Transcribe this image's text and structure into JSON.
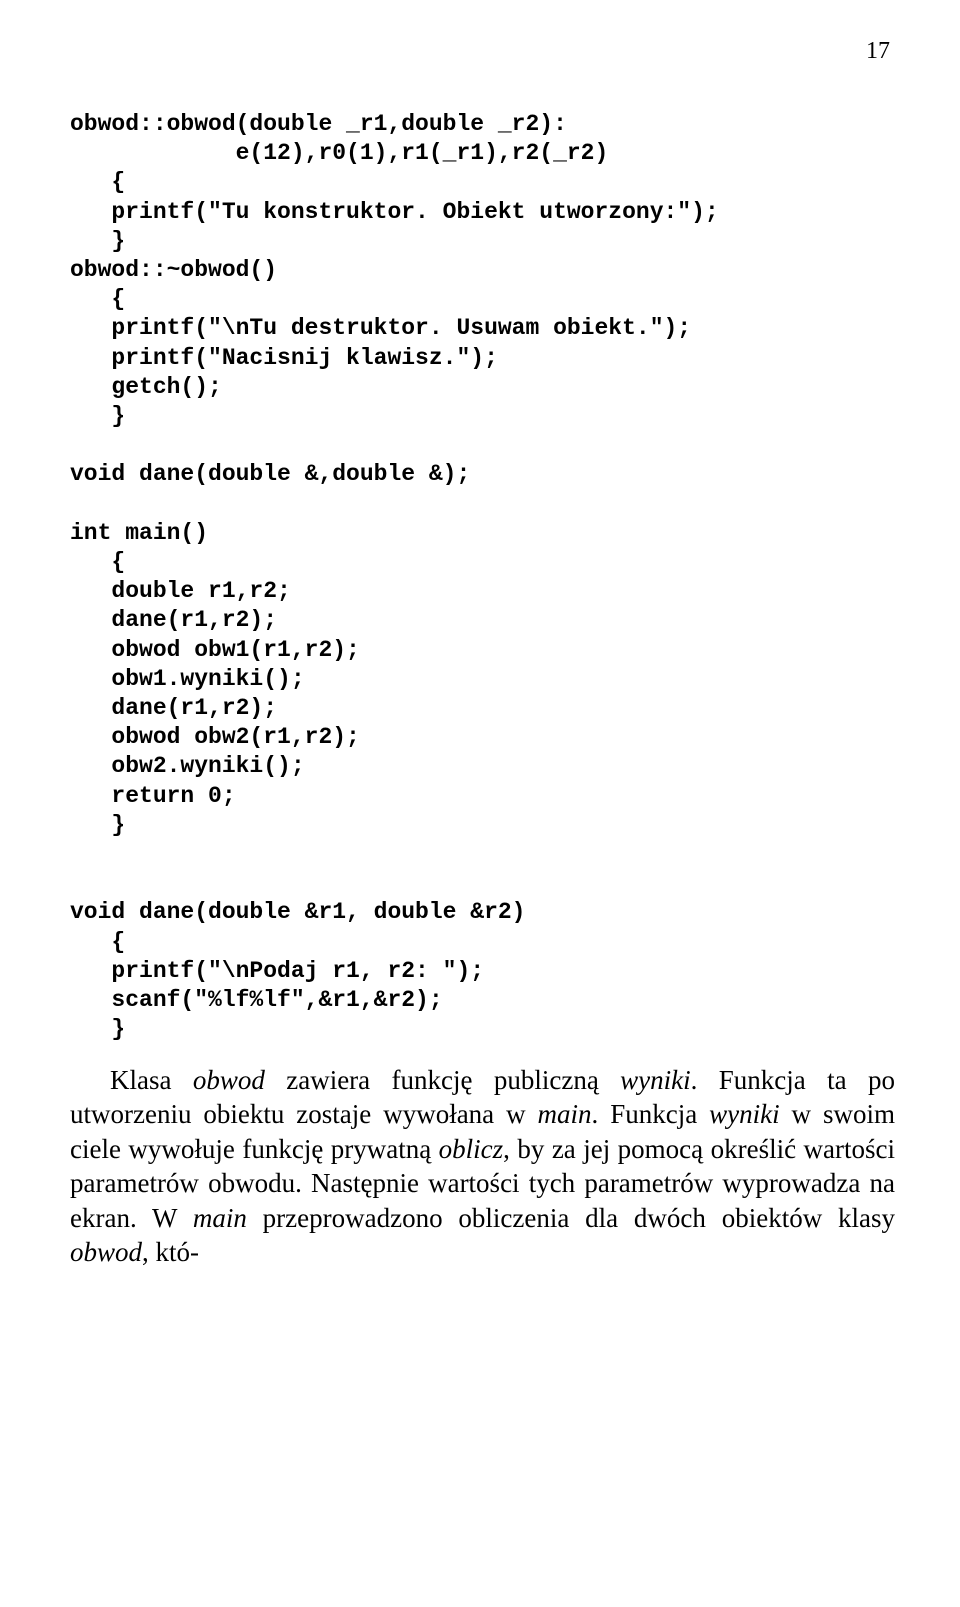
{
  "page_number": "17",
  "code": "obwod::obwod(double _r1,double _r2):\n            e(12),r0(1),r1(_r1),r2(_r2)\n   {\n   printf(\"Tu konstruktor. Obiekt utworzony:\");\n   }\nobwod::~obwod()\n   {\n   printf(\"\\nTu destruktor. Usuwam obiekt.\");\n   printf(\"Nacisnij klawisz.\");\n   getch();\n   }\n\nvoid dane(double &,double &);\n\nint main()\n   {\n   double r1,r2;\n   dane(r1,r2);\n   obwod obw1(r1,r2);\n   obw1.wyniki();\n   dane(r1,r2);\n   obwod obw2(r1,r2);\n   obw2.wyniki();\n   return 0;\n   }\n\n\nvoid dane(double &r1, double &r2)\n   {\n   printf(\"\\nPodaj r1, r2: \");\n   scanf(\"%lf%lf\",&r1,&r2);\n   }",
  "paragraph": {
    "p1_a": "Klasa ",
    "p1_b": "obwod",
    "p1_c": " zawiera funkcję publiczną ",
    "p1_d": "wyniki",
    "p1_e": ". Funkcja ta po utworzeniu obiektu zostaje wywołana w ",
    "p1_f": "main",
    "p1_g": ". Funkcja ",
    "p1_h": "wy­niki",
    "p1_i": " w swoim ciele wywołuje funkcję prywatną ",
    "p1_j": "oblicz",
    "p1_k": ", by za jej pomocą określić wartości parametrów obwodu. Następnie war­tości tych parametrów wyprowadza na ekran. W ",
    "p1_l": "main",
    "p1_m": " prze­prowadzono obliczenia dla dwóch obiektów klasy ",
    "p1_n": "obwod",
    "p1_o": ", któ-"
  }
}
